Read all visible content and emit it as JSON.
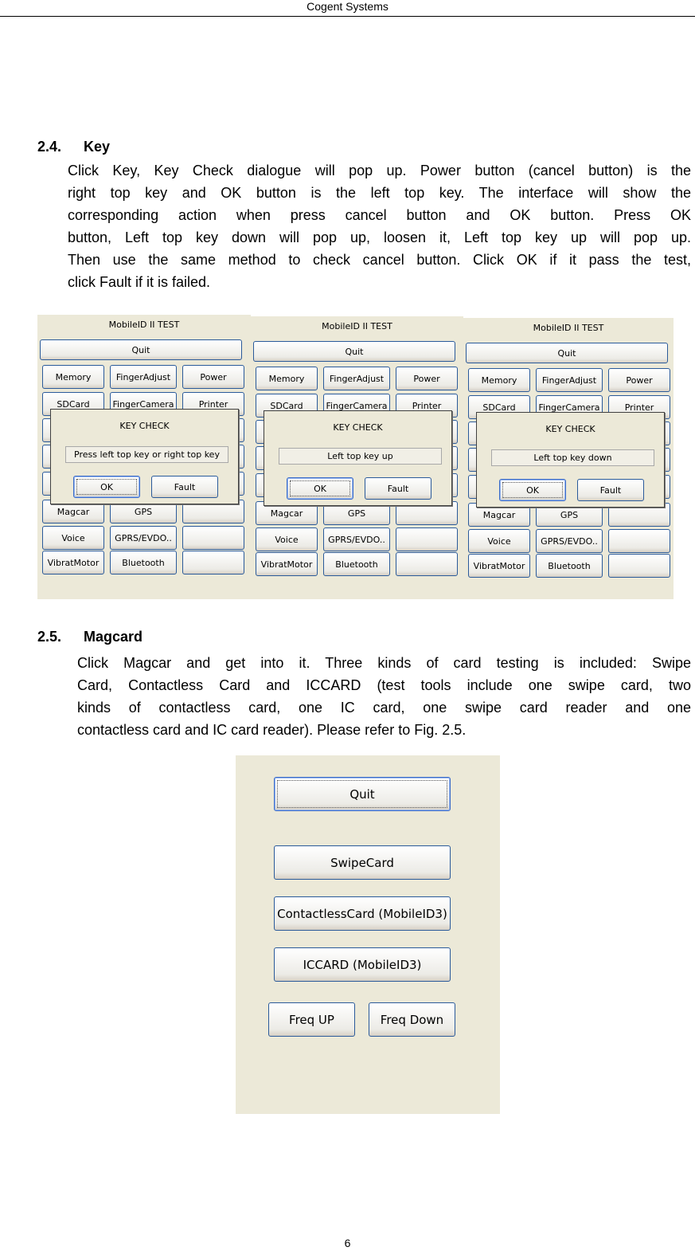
{
  "header": "Cogent Systems",
  "sections": [
    {
      "number": "2.4.",
      "title": "Key",
      "lines": [
        "Click Key, Key Check dialogue will pop up. Power button (cancel button) is the",
        "right top key and OK button is the left top key. The interface will show the",
        "corresponding action when press cancel button and OK button. Press OK",
        "button, Left top key down will pop up, loosen it, Left top key up will pop up.",
        "Then use the same method to check cancel button. Click OK if it pass the test,",
        "click Fault if it is failed."
      ]
    },
    {
      "number": "2.5.",
      "title": "Magcard",
      "lines": [
        "Click Magcar and get into it. Three kinds of card testing is included: Swipe",
        "Card, Contactless Card and ICCARD (test tools include one swipe card, two",
        "kinds of contactless card, one IC card, one swipe card reader and one",
        "contactless card and IC card reader). Please refer to Fig. 2.5."
      ]
    }
  ],
  "key_panels": {
    "title": "MobileID II TEST",
    "quit": "Quit",
    "grid": [
      [
        "Memory",
        "FingerAdjust",
        "Power"
      ],
      [
        "SDCard",
        "FingerCamera",
        "Printer"
      ],
      [
        "",
        "",
        ""
      ],
      [
        "",
        "",
        ""
      ],
      [
        "",
        "",
        ""
      ],
      [
        "Magcar",
        "GPS",
        ""
      ],
      [
        "Voice",
        "GPRS/EVDO..",
        ""
      ],
      [
        "VibratMotor",
        "Bluetooth",
        ""
      ]
    ],
    "dialog_title": "KEY CHECK",
    "ok": "OK",
    "fault": "Fault",
    "statuses": [
      "Press left top key or right top key",
      "Left top key up",
      "Left top key down"
    ]
  },
  "magcard": {
    "buttons": [
      "Quit",
      "SwipeCard",
      "ContactlessCard (MobileID3)",
      "ICCARD (MobileID3)",
      "Freq UP",
      "Freq Down"
    ]
  },
  "page_number": "6",
  "colors": {
    "panel_bg": "#ece9d8",
    "button_border": "#2a5a9a"
  }
}
